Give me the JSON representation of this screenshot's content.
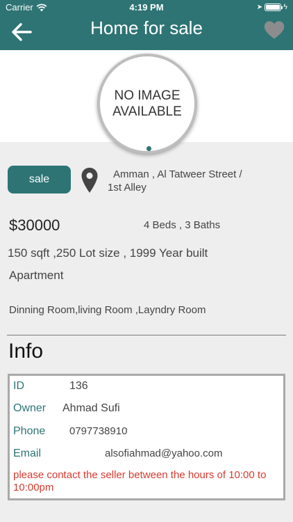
{
  "status_bar": {
    "carrier": "Carrier",
    "time": "4:19 PM"
  },
  "header": {
    "title": "Home for sale",
    "back_icon": "arrow-left-icon",
    "favorite_icon": "heart-icon"
  },
  "gallery": {
    "placeholder": "NO IMAGE AVAILABLE",
    "page_count": 1,
    "current_page": 1
  },
  "listing": {
    "status": "sale",
    "address_line1": "Amman ,  Al Tatweer Street /",
    "address_line2": "1st Alley",
    "price": "$30000",
    "beds_baths": "4 Beds , 3 Baths",
    "sizes": "150 sqft ,250 Lot size ,  1999 Year built",
    "property_type": "Apartment",
    "rooms": "Dinning Room,living Room ,Layndry Room"
  },
  "info": {
    "heading": "Info",
    "id_label": "ID",
    "id_value": "136",
    "owner_label": "Owner",
    "owner_value": "Ahmad  Sufi",
    "phone_label": "Phone",
    "phone_value": "0797738910",
    "email_label": "Email",
    "email_value": "alsofiahmad@yahoo.com",
    "notice": "please contact the seller between the hours of 10:00 to 10:00pm"
  },
  "colors": {
    "brand": "#2e7475",
    "notice": "#d63a2f",
    "background": "#eeeeef"
  }
}
